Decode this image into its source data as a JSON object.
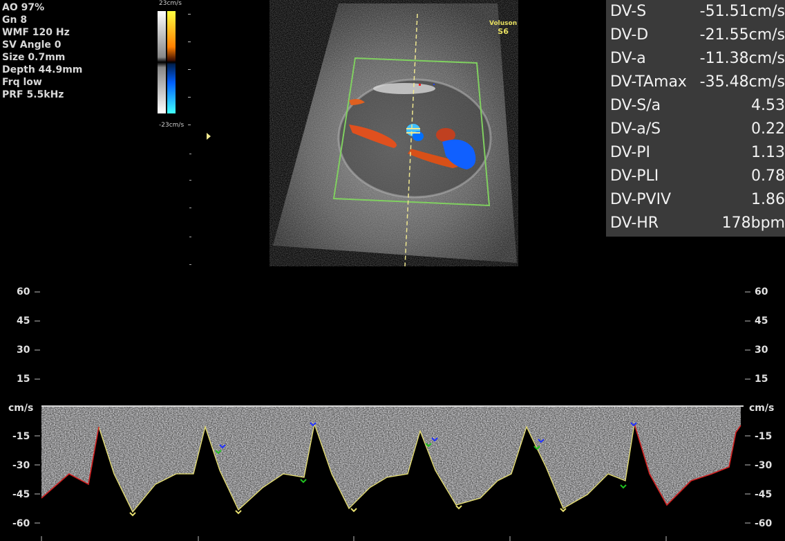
{
  "params": {
    "lines": [
      "AO 97%",
      "Gn  8",
      "WMF 120 Hz",
      "SV Angle  0",
      "Size  0.7mm",
      "Depth 44.9mm",
      "Frq low",
      "PRF  5.5kHz"
    ]
  },
  "colorbar": {
    "top_label": "23cm/s",
    "bottom_label": "-23cm/s"
  },
  "brand": {
    "name": "Voluson",
    "model": "S6"
  },
  "measurements": [
    {
      "label": "DV-S",
      "value": "-51.51cm/s"
    },
    {
      "label": "DV-D",
      "value": "-21.55cm/s"
    },
    {
      "label": "DV-a",
      "value": "-11.38cm/s"
    },
    {
      "label": "DV-TAmax",
      "value": "-35.48cm/s"
    },
    {
      "label": "DV-S/a",
      "value": "4.53"
    },
    {
      "label": "DV-a/S",
      "value": "0.22"
    },
    {
      "label": "DV-PI",
      "value": "1.13"
    },
    {
      "label": "DV-PLI",
      "value": "0.78"
    },
    {
      "label": "DV-PVIV",
      "value": "1.86"
    },
    {
      "label": "DV-HR",
      "value": "178bpm"
    }
  ],
  "spectral_axis": {
    "unit": "cm/s",
    "positive_ticks": [
      "60",
      "45",
      "30",
      "15"
    ],
    "negative_ticks": [
      "-15",
      "-30",
      "-45",
      "-60"
    ]
  },
  "colors": {
    "measure_bg": "#3a3a3a",
    "envelope_yellow": "#e8e070",
    "envelope_red": "#d02020",
    "box_green": "#80d060"
  }
}
